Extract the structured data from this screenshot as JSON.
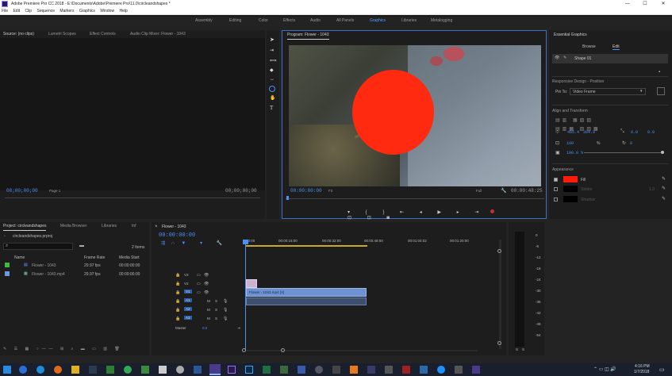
{
  "window": {
    "title": "Adobe Premiere Pro CC 2018 - E:\\Documents\\Adobe\\Premiere Pro\\11.0\\circleandshapes *",
    "minimize": "—",
    "maximize": "☐",
    "close": "✕"
  },
  "menu": [
    "File",
    "Edit",
    "Clip",
    "Sequence",
    "Markers",
    "Graphics",
    "Window",
    "Help"
  ],
  "workspaces": [
    "Assembly",
    "Editing",
    "Color",
    "Effects",
    "Audio",
    "All Panels",
    "Graphics",
    "Libraries",
    "Metalogging"
  ],
  "active_workspace": "Graphics",
  "source_panel": {
    "tabs": [
      "Source: (no clips)",
      "Lumetri Scopes",
      "Effect Controls",
      "Audio Clip Mixer: Flower - 1043"
    ],
    "timecode_left": "00;00;00;00",
    "page": "Page 1",
    "timecode_right": "00;00;00;00"
  },
  "program_panel": {
    "tab": "Program: Flower - 1043",
    "timecode_left": "00:00:00:00",
    "fit": "Fit",
    "quality": "Full",
    "timecode_right": "00:00:48:25",
    "accent_circle": "#ff2a10"
  },
  "essential_graphics": {
    "title": "Essential Graphics",
    "tabs": [
      "Browse",
      "Edit"
    ],
    "active_tab": "Edit",
    "layer": "Shape 01",
    "responsive_design": "Responsive Design - Position",
    "pin_to_label": "Pin To:",
    "pin_to_value": "Video Frame",
    "align_transform": "Align and Transform",
    "pos_x": "465.4",
    "pos_y": "304.9",
    "anchor_x": "0.0",
    "anchor_y": "0.0",
    "scale": "100",
    "scale_unit": "%",
    "rotation": "0",
    "opacity": "100.0 %",
    "appearance": "Appearance",
    "fill_label": "Fill",
    "stroke_label": "Stroke",
    "shadow_label": "Shadow",
    "stroke_value": "1.0",
    "fill_color": "#ff1a0a",
    "stroke_color": "#000000",
    "shadow_color": "#000000"
  },
  "project_panel": {
    "tabs": [
      "Project: circleandshapes",
      "Media Browser",
      "Libraries",
      "Inf"
    ],
    "file": "circleandshapes.prproj",
    "items_count": "2 Items",
    "columns": [
      "Name",
      "Frame Rate",
      "Media Start"
    ],
    "rows": [
      {
        "name": "Flower - 1043",
        "rate": "29.97 fps",
        "start": "00:00:00:00",
        "color": "#3cbc3c"
      },
      {
        "name": "Flower - 1043.mp4",
        "rate": "29.97 fps",
        "start": "00:00:00:00",
        "color": "#6a9ae0"
      }
    ]
  },
  "timeline": {
    "tab": "Flower - 1043",
    "timecode": "00:00:00:00",
    "ruler": [
      "00:00",
      "00:00:16:00",
      "00:00:32:00",
      "00:00:48:00",
      "00:01:04:02",
      "00:01:20:00"
    ],
    "tracks": [
      "V3",
      "V2",
      "V1",
      "A1",
      "A2",
      "A3"
    ],
    "master": "Master",
    "master_value": "0.0",
    "clip_graphic": "",
    "clip_video": "Flower - 1043.mp4 [V]"
  },
  "audio_meter": {
    "scale": [
      "0",
      "-6",
      "-12",
      "-18",
      "-24",
      "-30",
      "-36",
      "-42",
      "-48",
      "-54"
    ],
    "solo_left": "S",
    "solo_right": "S"
  },
  "taskbar": {
    "time": "4:16 PM",
    "date": "1/7/2018"
  }
}
